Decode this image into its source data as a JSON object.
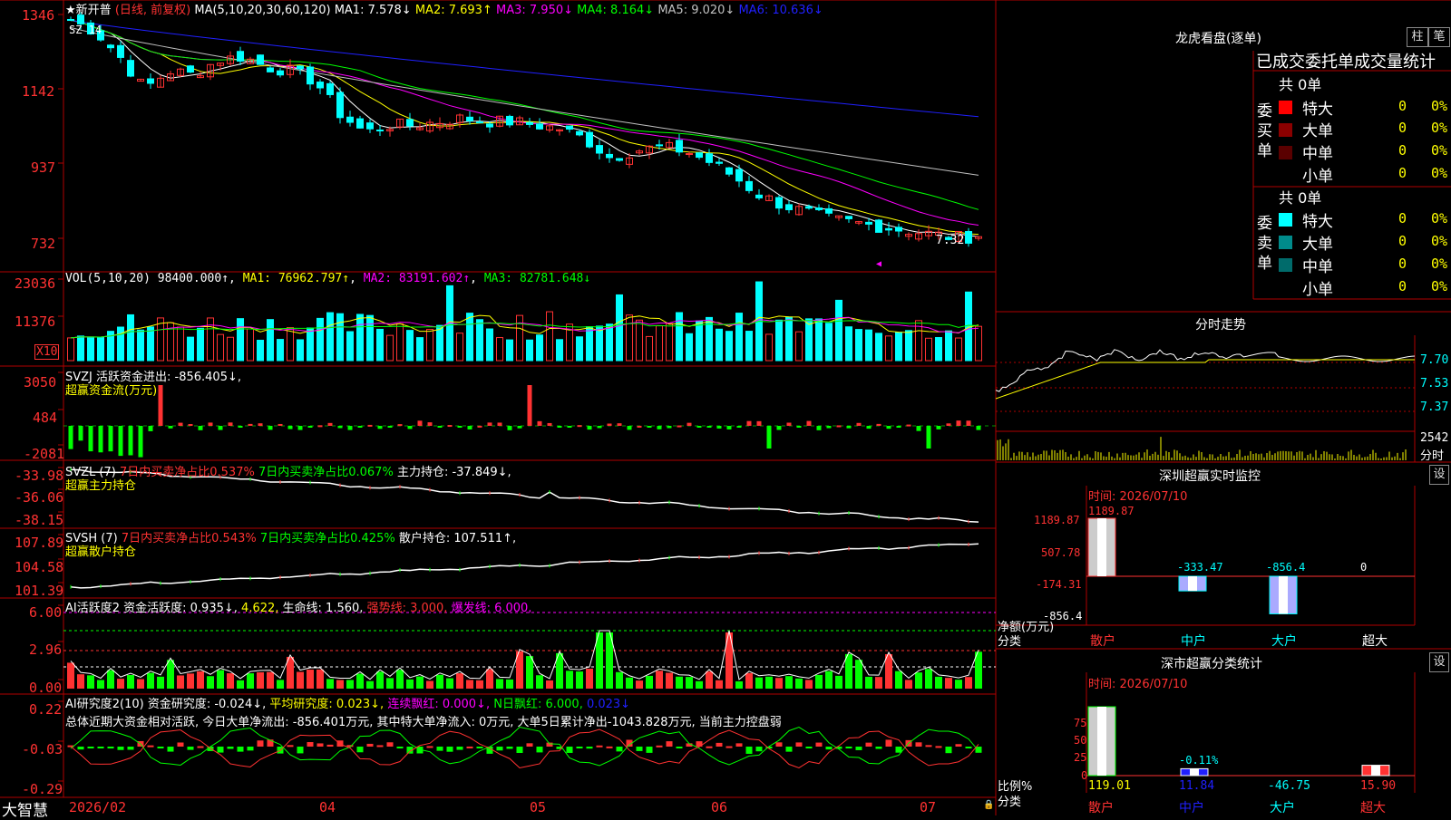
{
  "app_name": "大智慧",
  "stock": {
    "name": "新开普",
    "star": "★",
    "period": "(日线, 前复权)"
  },
  "colors": {
    "up": "#ff3232",
    "down": "#00ffff",
    "ma1": "#ffffff",
    "ma2": "#ffff00",
    "ma3": "#ff00ff",
    "ma4": "#00ff00",
    "ma5": "#c0c0c0",
    "ma6": "#2020ff",
    "grid": "#b00000"
  },
  "main_pane": {
    "formula": "MA(5,10,20,30,60,120)",
    "ma_labels": [
      "MA1: 7.578↓",
      "MA2: 7.693↑",
      "MA3: 7.950↓",
      "MA4: 8.164↓",
      "MA5: 9.020↓",
      "MA6: 10.636↓"
    ],
    "y_ticks": [
      "1346",
      "1142",
      "937",
      "732"
    ],
    "top_marker": "SZ 14",
    "price_tag": "7.32",
    "triangle": "◀"
  },
  "vol_pane": {
    "title": "VOL(5,10,20)",
    "value": "98400.000↑",
    "ma_labels": [
      "MA1: 76962.797↑",
      "MA2: 83191.602↑",
      "MA3: 82781.648↓"
    ],
    "y_ticks": [
      "23036",
      "11376"
    ],
    "unit": "X10"
  },
  "svzj_pane": {
    "title": "SVZJ  活跃资金进出: -856.405↓,",
    "subtitle": "超赢资金流(万元)",
    "y_ticks": [
      "3050",
      "484",
      "-2081"
    ]
  },
  "svzl_pane": {
    "title": "SVZL (7)",
    "label1": "7日内买卖净占比0.537%",
    "label2": "7日内买卖净占比0.067%",
    "label3": "主力持仓: -37.849↓,",
    "subtitle": "超赢主力持仓",
    "y_ticks": [
      "-33.98",
      "-36.06",
      "-38.15"
    ]
  },
  "svsh_pane": {
    "title": "SVSH (7)",
    "label1": "7日内买卖净占比0.543%",
    "label2": "7日内买卖净占比0.425%",
    "label3": "散户持仓: 107.511↑,",
    "subtitle": "超赢散户持仓",
    "y_ticks": [
      "107.89",
      "104.58",
      "101.39"
    ]
  },
  "ai_active_pane": {
    "title": "AI活跃度2",
    "label1": "资金活跃度: 0.935↓,",
    "label2": "4.622,",
    "label3": "生命线: 1.560,",
    "label4": "强势线: 3.000,",
    "label5": "爆发线: 6.000,",
    "y_ticks": [
      "6.00",
      "2.96",
      "0.00"
    ]
  },
  "ai_research_pane": {
    "title": "AI研究度2(10)",
    "label1": "资金研究度: -0.024↓,",
    "label2": "平均研究度: 0.023↓,",
    "label3": "连续飘红: 0.000↓,",
    "label4": "N日飘红: 6.000,",
    "label5": "0.023↓",
    "comment": "总体近期大资金相对活跃, 今日大单净流出: -856.401万元, 其中特大单净流入: 0万元, 大单5日累计净出-1043.828万元, 当前主力控盘弱",
    "y_ticks": [
      "0.22",
      "-0.03",
      "-0.29"
    ]
  },
  "x_axis": {
    "labels": [
      "2026/02",
      "04",
      "05",
      "06",
      "07"
    ]
  },
  "right_panel": {
    "dragon": {
      "title": "龙虎看盘(逐单)",
      "btn_col": "柱",
      "btn_pen": "笔",
      "stat_title": "已成交委托单成交量统计",
      "buy_side": "委买单",
      "sell_side": "委卖单",
      "buy_total": "共 0单",
      "sell_total": "共 0单",
      "buy_rows": [
        {
          "label": "特大",
          "count": "0",
          "pct": "0%",
          "color": "#ff0000"
        },
        {
          "label": "大单",
          "count": "0",
          "pct": "0%",
          "color": "#8b0000"
        },
        {
          "label": "中单",
          "count": "0",
          "pct": "0%",
          "color": "#5a0000"
        },
        {
          "label": "小单",
          "count": "0",
          "pct": "0%",
          "color": ""
        }
      ],
      "sell_rows": [
        {
          "label": "特大",
          "count": "0",
          "pct": "0%",
          "color": "#00ffff"
        },
        {
          "label": "大单",
          "count": "0",
          "pct": "0%",
          "color": "#008b8b"
        },
        {
          "label": "中单",
          "count": "0",
          "pct": "0%",
          "color": "#006b6b"
        },
        {
          "label": "小单",
          "count": "0",
          "pct": "0%",
          "color": ""
        }
      ]
    },
    "intraday": {
      "title": "分时走势",
      "y_ticks": [
        "7.70",
        "7.53",
        "7.37"
      ],
      "vol_tick": "2542",
      "vol_unit": "分时"
    },
    "sz_monitor": {
      "title": "深圳超赢实时监控",
      "btn": "设",
      "time_label": "时间: 2026/07/10",
      "y_ticks": [
        "1189.87",
        "507.78",
        "-174.31",
        "-856.4"
      ],
      "unit_label": "净额(万元)",
      "cat_label": "分类",
      "categories": [
        "散户",
        "中户",
        "大户",
        "超大"
      ],
      "values": [
        1189.87,
        -333.47,
        -856.4,
        0
      ],
      "value_labels": [
        "1189.87",
        "-333.47",
        "-856.4",
        "0"
      ]
    },
    "sz_class": {
      "title": "深市超赢分类统计",
      "btn": "设",
      "time_label": "时间: 2026/07/10",
      "y_ticks": [
        "75",
        "50",
        "25",
        "0"
      ],
      "unit_label": "比例%",
      "cat_label": "分类",
      "categories": [
        "散户",
        "中户",
        "大户",
        "超大"
      ],
      "bar_pcts": [
        100,
        10,
        0,
        15
      ],
      "value_labels": [
        "119.01",
        "11.84",
        "-46.75",
        "15.90"
      ],
      "mid_label": "-0.11%"
    }
  },
  "chart_data": [
    {
      "type": "candlestick",
      "title": "新开普 (日线, 前复权)",
      "x_labels": [
        "2026/02",
        "04",
        "05",
        "06",
        "07"
      ],
      "close": [
        13.3,
        13.0,
        12.3,
        11.4,
        11.9,
        11.8,
        12.2,
        12.3,
        12.0,
        11.9,
        11.6,
        10.7,
        10.2,
        10.4,
        10.4,
        10.5,
        10.6,
        10.5,
        10.5,
        10.4,
        10.3,
        10.0,
        9.5,
        9.7,
        9.8,
        9.7,
        9.4,
        9.0,
        8.5,
        8.2,
        8.0,
        7.8,
        7.7,
        7.6,
        7.5,
        7.4,
        7.3,
        7.32
      ],
      "ma": {
        "MA1": 7.578,
        "MA2": 7.693,
        "MA3": 7.95,
        "MA4": 8.164,
        "MA5": 9.02,
        "MA6": 10.636
      },
      "last_price": 7.32
    },
    {
      "type": "bar",
      "title": "VOL(5,10,20)",
      "values": [
        98400.0
      ],
      "ma": {
        "MA1": 76962.797,
        "MA2": 83191.602,
        "MA3": 82781.648
      }
    },
    {
      "type": "bar",
      "title": "深圳超赢实时监控",
      "categories": [
        "散户",
        "中户",
        "大户",
        "超大"
      ],
      "values": [
        1189.87,
        -333.47,
        -856.4,
        0
      ],
      "ylabel": "净额(万元)"
    },
    {
      "type": "bar",
      "title": "深市超赢分类统计",
      "categories": [
        "散户",
        "中户",
        "大户",
        "超大"
      ],
      "values": [
        119.01,
        11.84,
        -46.75,
        15.9
      ],
      "ylabel": "比例%"
    }
  ]
}
